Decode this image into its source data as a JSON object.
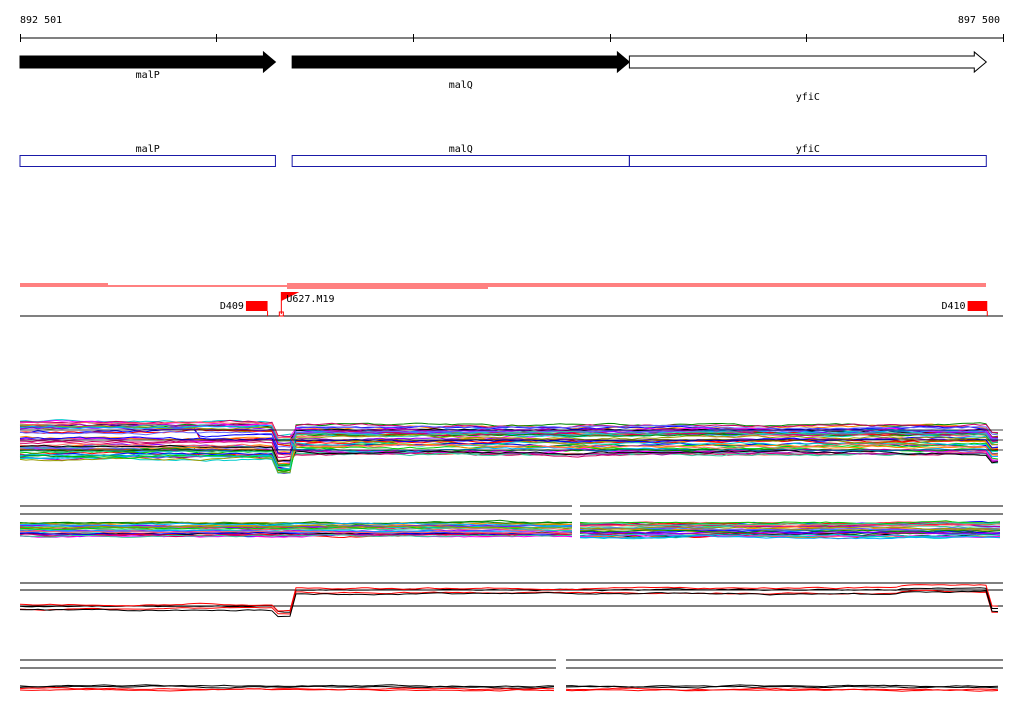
{
  "ruler": {
    "start_label": "892 501",
    "end_label": "897 500",
    "start": 892501,
    "end": 897500
  },
  "genes": [
    {
      "name": "malP",
      "start": 892501,
      "end": 893800,
      "fill": "#000000",
      "strand": "+"
    },
    {
      "name": "malQ",
      "start": 893885,
      "end": 895600,
      "fill": "#000000",
      "strand": "+"
    },
    {
      "name": "yfiC",
      "start": 895600,
      "end": 897415,
      "fill": "#ffffff",
      "strand": "+"
    }
  ],
  "transcripts": [
    {
      "name": "malP",
      "start": 892501,
      "end": 893800
    },
    {
      "name": "malQ",
      "start": 893885,
      "end": 895600
    },
    {
      "name": "yfiC",
      "start": 895600,
      "end": 897415
    }
  ],
  "features": [
    {
      "label": "D409",
      "kind": "block",
      "start": 893650,
      "end": 893760
    },
    {
      "label": "U627.M19",
      "kind": "flag",
      "position": 893830
    },
    {
      "label": "D410",
      "kind": "block",
      "start": 897320,
      "end": 897420
    }
  ],
  "colors": {
    "gene_outline": "#000000",
    "transcript_outline": "#1a1aa8",
    "feature": "#ff0000",
    "track_line": "#000000"
  }
}
